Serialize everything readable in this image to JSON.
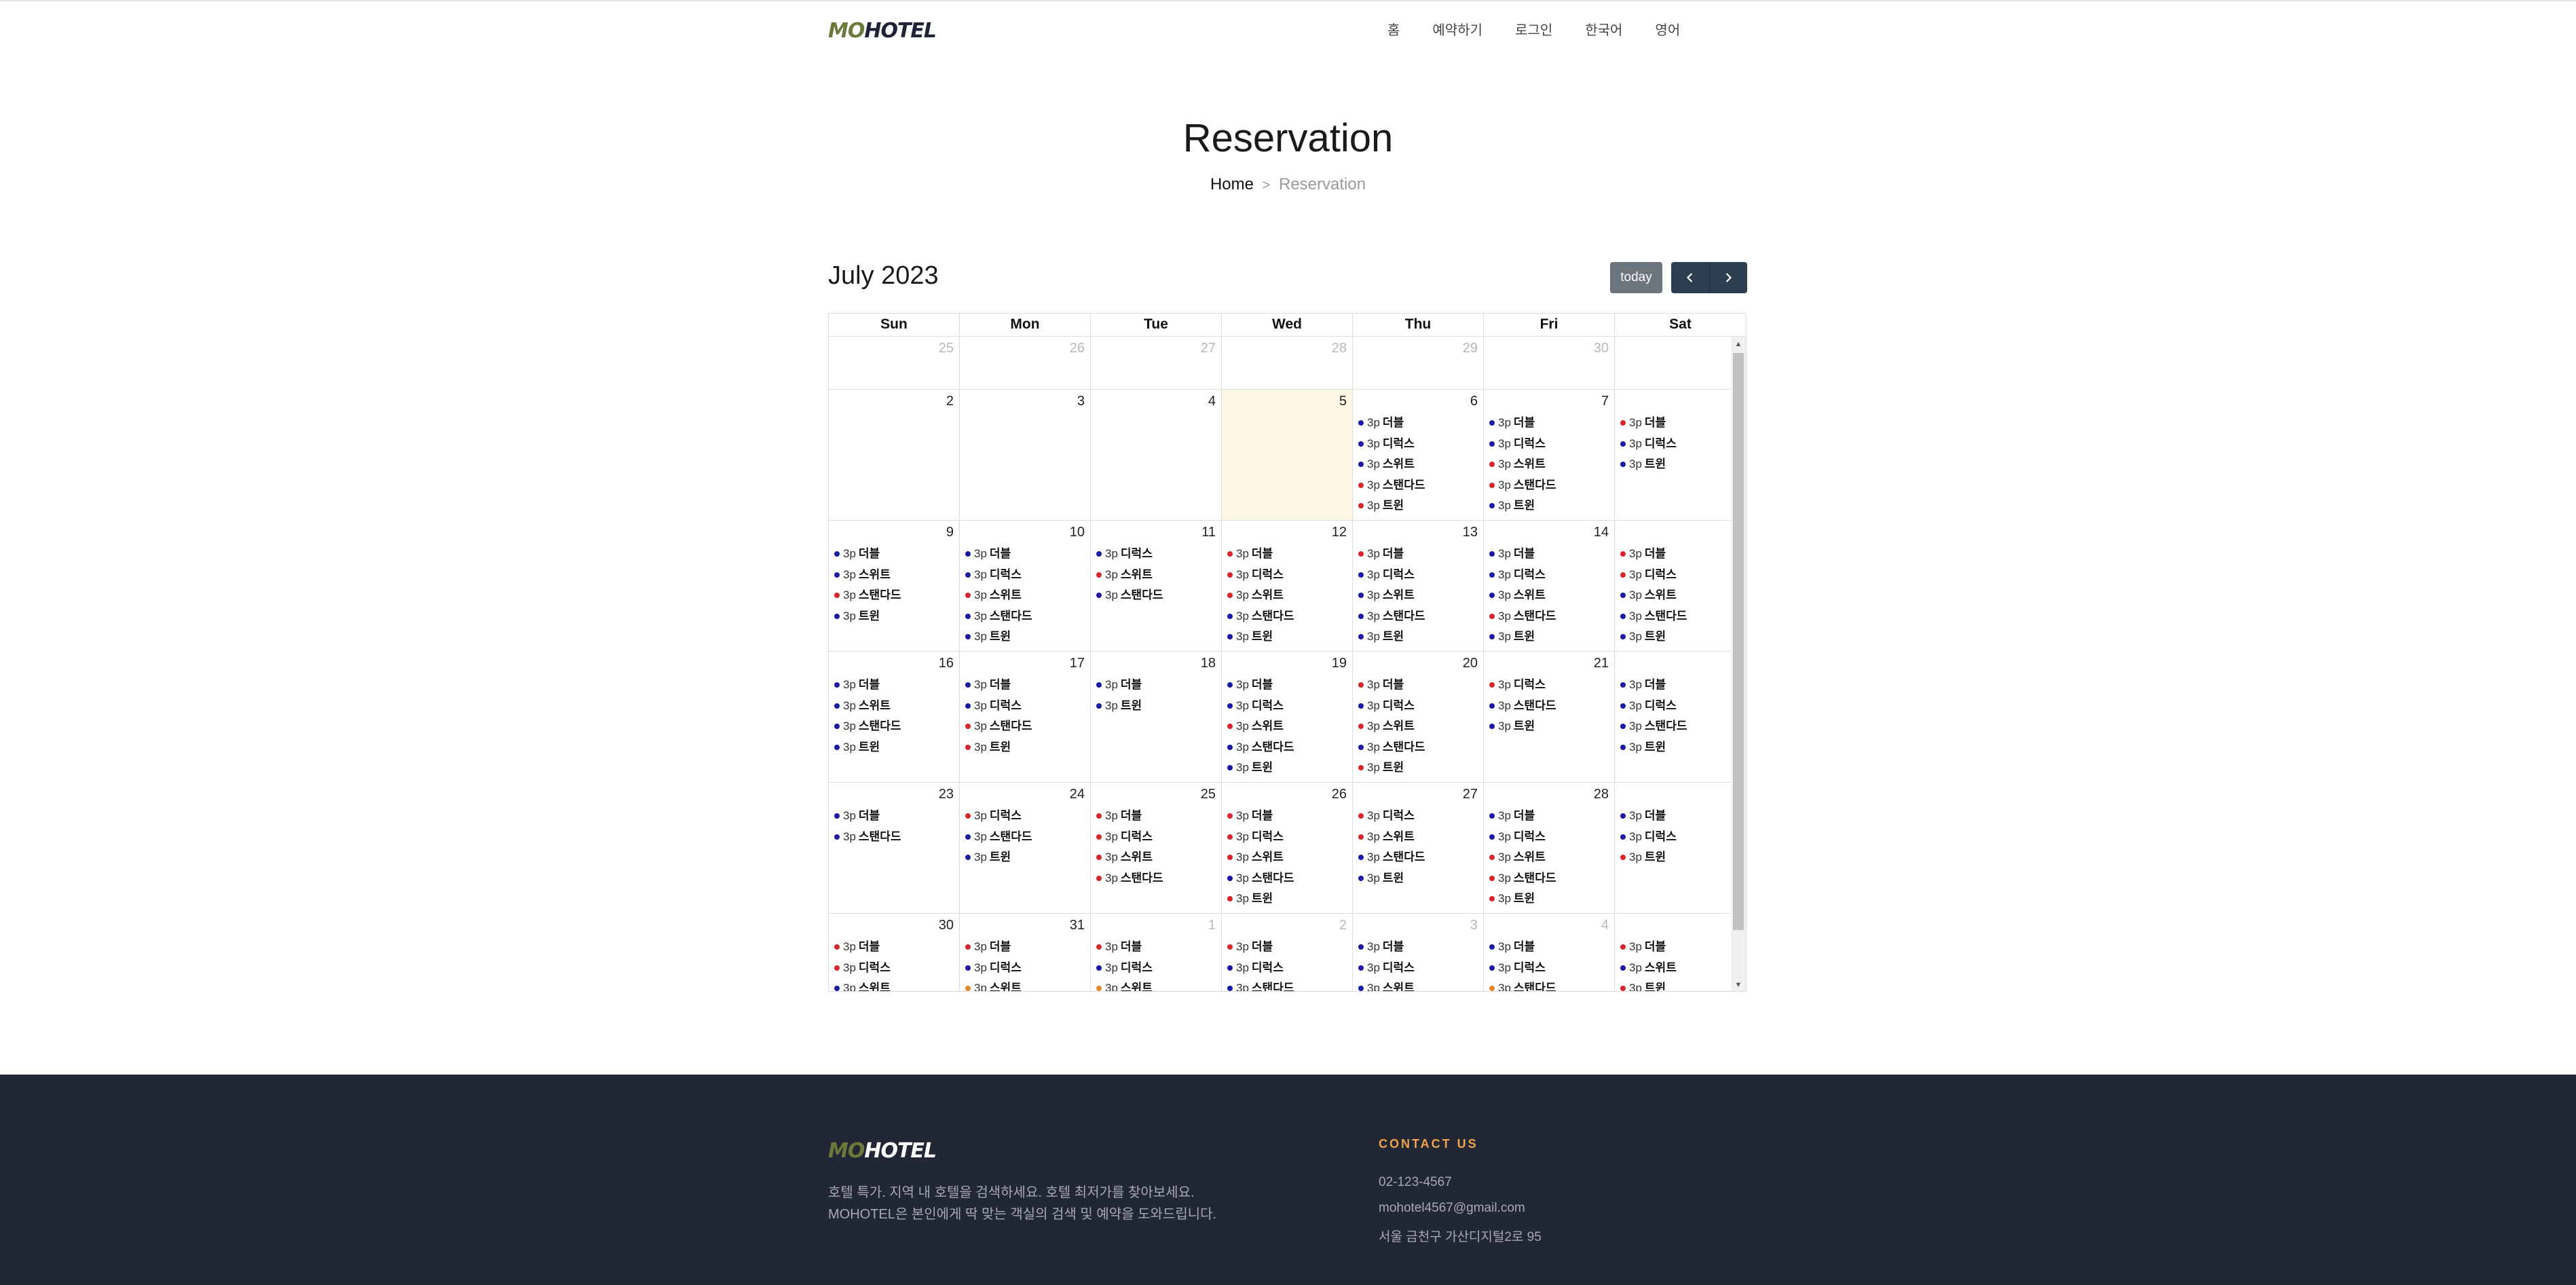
{
  "nav": {
    "logo": {
      "part1": "MO",
      "part2": "HOTEL"
    },
    "links": [
      "홈",
      "예약하기",
      "로그인",
      "한국어",
      "영어"
    ]
  },
  "hero": {
    "title": "Reservation",
    "breadcrumb": {
      "home": "Home",
      "separator": ">",
      "current": "Reservation"
    }
  },
  "calendar": {
    "title": "July 2023",
    "today_label": "today",
    "weekdays": [
      "Sun",
      "Mon",
      "Tue",
      "Wed",
      "Thu",
      "Fri",
      "Sat"
    ],
    "colors": {
      "blue": "#1a1aa6",
      "red": "#d9262c",
      "orange": "#e08a2a",
      "today_bg": "#fcf8e3"
    },
    "weeks": [
      [
        {
          "day": "25",
          "other": true,
          "events": []
        },
        {
          "day": "26",
          "other": true,
          "events": []
        },
        {
          "day": "27",
          "other": true,
          "events": []
        },
        {
          "day": "28",
          "other": true,
          "events": []
        },
        {
          "day": "29",
          "other": true,
          "events": []
        },
        {
          "day": "30",
          "other": true,
          "events": []
        },
        {
          "day": "",
          "other": false,
          "events": []
        }
      ],
      [
        {
          "day": "2",
          "events": []
        },
        {
          "day": "3",
          "events": []
        },
        {
          "day": "4",
          "events": []
        },
        {
          "day": "5",
          "today": true,
          "events": []
        },
        {
          "day": "6",
          "events": [
            {
              "time": "3p",
              "name": "더블",
              "color": "blue"
            },
            {
              "time": "3p",
              "name": "디럭스",
              "color": "blue"
            },
            {
              "time": "3p",
              "name": "스위트",
              "color": "blue"
            },
            {
              "time": "3p",
              "name": "스탠다드",
              "color": "red"
            },
            {
              "time": "3p",
              "name": "트윈",
              "color": "red"
            }
          ]
        },
        {
          "day": "7",
          "events": [
            {
              "time": "3p",
              "name": "더블",
              "color": "blue"
            },
            {
              "time": "3p",
              "name": "디럭스",
              "color": "blue"
            },
            {
              "time": "3p",
              "name": "스위트",
              "color": "red"
            },
            {
              "time": "3p",
              "name": "스탠다드",
              "color": "red"
            },
            {
              "time": "3p",
              "name": "트윈",
              "color": "blue"
            }
          ]
        },
        {
          "day": "",
          "events": [
            {
              "time": "3p",
              "name": "더블",
              "color": "red"
            },
            {
              "time": "3p",
              "name": "디럭스",
              "color": "blue"
            },
            {
              "time": "3p",
              "name": "트윈",
              "color": "blue"
            }
          ]
        }
      ],
      [
        {
          "day": "9",
          "events": [
            {
              "time": "3p",
              "name": "더블",
              "color": "blue"
            },
            {
              "time": "3p",
              "name": "스위트",
              "color": "blue"
            },
            {
              "time": "3p",
              "name": "스탠다드",
              "color": "red"
            },
            {
              "time": "3p",
              "name": "트윈",
              "color": "blue"
            }
          ]
        },
        {
          "day": "10",
          "events": [
            {
              "time": "3p",
              "name": "더블",
              "color": "blue"
            },
            {
              "time": "3p",
              "name": "디럭스",
              "color": "blue"
            },
            {
              "time": "3p",
              "name": "스위트",
              "color": "red"
            },
            {
              "time": "3p",
              "name": "스탠다드",
              "color": "blue"
            },
            {
              "time": "3p",
              "name": "트윈",
              "color": "blue"
            }
          ]
        },
        {
          "day": "11",
          "events": [
            {
              "time": "3p",
              "name": "디럭스",
              "color": "blue"
            },
            {
              "time": "3p",
              "name": "스위트",
              "color": "red"
            },
            {
              "time": "3p",
              "name": "스탠다드",
              "color": "blue"
            }
          ]
        },
        {
          "day": "12",
          "events": [
            {
              "time": "3p",
              "name": "더블",
              "color": "red"
            },
            {
              "time": "3p",
              "name": "디럭스",
              "color": "red"
            },
            {
              "time": "3p",
              "name": "스위트",
              "color": "red"
            },
            {
              "time": "3p",
              "name": "스탠다드",
              "color": "blue"
            },
            {
              "time": "3p",
              "name": "트윈",
              "color": "blue"
            }
          ]
        },
        {
          "day": "13",
          "events": [
            {
              "time": "3p",
              "name": "더블",
              "color": "red"
            },
            {
              "time": "3p",
              "name": "디럭스",
              "color": "blue"
            },
            {
              "time": "3p",
              "name": "스위트",
              "color": "blue"
            },
            {
              "time": "3p",
              "name": "스탠다드",
              "color": "blue"
            },
            {
              "time": "3p",
              "name": "트윈",
              "color": "blue"
            }
          ]
        },
        {
          "day": "14",
          "events": [
            {
              "time": "3p",
              "name": "더블",
              "color": "blue"
            },
            {
              "time": "3p",
              "name": "디럭스",
              "color": "blue"
            },
            {
              "time": "3p",
              "name": "스위트",
              "color": "blue"
            },
            {
              "time": "3p",
              "name": "스탠다드",
              "color": "red"
            },
            {
              "time": "3p",
              "name": "트윈",
              "color": "blue"
            }
          ]
        },
        {
          "day": "",
          "events": [
            {
              "time": "3p",
              "name": "더블",
              "color": "red"
            },
            {
              "time": "3p",
              "name": "디럭스",
              "color": "red"
            },
            {
              "time": "3p",
              "name": "스위트",
              "color": "blue"
            },
            {
              "time": "3p",
              "name": "스탠다드",
              "color": "blue"
            },
            {
              "time": "3p",
              "name": "트윈",
              "color": "blue"
            }
          ]
        }
      ],
      [
        {
          "day": "16",
          "events": [
            {
              "time": "3p",
              "name": "더블",
              "color": "blue"
            },
            {
              "time": "3p",
              "name": "스위트",
              "color": "blue"
            },
            {
              "time": "3p",
              "name": "스탠다드",
              "color": "blue"
            },
            {
              "time": "3p",
              "name": "트윈",
              "color": "blue"
            }
          ]
        },
        {
          "day": "17",
          "events": [
            {
              "time": "3p",
              "name": "더블",
              "color": "blue"
            },
            {
              "time": "3p",
              "name": "디럭스",
              "color": "blue"
            },
            {
              "time": "3p",
              "name": "스탠다드",
              "color": "red"
            },
            {
              "time": "3p",
              "name": "트윈",
              "color": "red"
            }
          ]
        },
        {
          "day": "18",
          "events": [
            {
              "time": "3p",
              "name": "더블",
              "color": "blue"
            },
            {
              "time": "3p",
              "name": "트윈",
              "color": "blue"
            }
          ]
        },
        {
          "day": "19",
          "events": [
            {
              "time": "3p",
              "name": "더블",
              "color": "blue"
            },
            {
              "time": "3p",
              "name": "디럭스",
              "color": "blue"
            },
            {
              "time": "3p",
              "name": "스위트",
              "color": "red"
            },
            {
              "time": "3p",
              "name": "스탠다드",
              "color": "blue"
            },
            {
              "time": "3p",
              "name": "트윈",
              "color": "blue"
            }
          ]
        },
        {
          "day": "20",
          "events": [
            {
              "time": "3p",
              "name": "더블",
              "color": "red"
            },
            {
              "time": "3p",
              "name": "디럭스",
              "color": "blue"
            },
            {
              "time": "3p",
              "name": "스위트",
              "color": "red"
            },
            {
              "time": "3p",
              "name": "스탠다드",
              "color": "blue"
            },
            {
              "time": "3p",
              "name": "트윈",
              "color": "red"
            }
          ]
        },
        {
          "day": "21",
          "events": [
            {
              "time": "3p",
              "name": "디럭스",
              "color": "red"
            },
            {
              "time": "3p",
              "name": "스탠다드",
              "color": "blue"
            },
            {
              "time": "3p",
              "name": "트윈",
              "color": "blue"
            }
          ]
        },
        {
          "day": "",
          "events": [
            {
              "time": "3p",
              "name": "더블",
              "color": "blue"
            },
            {
              "time": "3p",
              "name": "디럭스",
              "color": "blue"
            },
            {
              "time": "3p",
              "name": "스탠다드",
              "color": "blue"
            },
            {
              "time": "3p",
              "name": "트윈",
              "color": "blue"
            }
          ]
        }
      ],
      [
        {
          "day": "23",
          "events": [
            {
              "time": "3p",
              "name": "더블",
              "color": "blue"
            },
            {
              "time": "3p",
              "name": "스탠다드",
              "color": "blue"
            }
          ]
        },
        {
          "day": "24",
          "events": [
            {
              "time": "3p",
              "name": "디럭스",
              "color": "red"
            },
            {
              "time": "3p",
              "name": "스탠다드",
              "color": "blue"
            },
            {
              "time": "3p",
              "name": "트윈",
              "color": "blue"
            }
          ]
        },
        {
          "day": "25",
          "events": [
            {
              "time": "3p",
              "name": "더블",
              "color": "red"
            },
            {
              "time": "3p",
              "name": "디럭스",
              "color": "red"
            },
            {
              "time": "3p",
              "name": "스위트",
              "color": "red"
            },
            {
              "time": "3p",
              "name": "스탠다드",
              "color": "red"
            }
          ]
        },
        {
          "day": "26",
          "events": [
            {
              "time": "3p",
              "name": "더블",
              "color": "red"
            },
            {
              "time": "3p",
              "name": "디럭스",
              "color": "red"
            },
            {
              "time": "3p",
              "name": "스위트",
              "color": "red"
            },
            {
              "time": "3p",
              "name": "스탠다드",
              "color": "blue"
            },
            {
              "time": "3p",
              "name": "트윈",
              "color": "red"
            }
          ]
        },
        {
          "day": "27",
          "events": [
            {
              "time": "3p",
              "name": "디럭스",
              "color": "red"
            },
            {
              "time": "3p",
              "name": "스위트",
              "color": "red"
            },
            {
              "time": "3p",
              "name": "스탠다드",
              "color": "blue"
            },
            {
              "time": "3p",
              "name": "트윈",
              "color": "blue"
            }
          ]
        },
        {
          "day": "28",
          "events": [
            {
              "time": "3p",
              "name": "더블",
              "color": "blue"
            },
            {
              "time": "3p",
              "name": "디럭스",
              "color": "blue"
            },
            {
              "time": "3p",
              "name": "스위트",
              "color": "red"
            },
            {
              "time": "3p",
              "name": "스탠다드",
              "color": "red"
            },
            {
              "time": "3p",
              "name": "트윈",
              "color": "red"
            }
          ]
        },
        {
          "day": "",
          "events": [
            {
              "time": "3p",
              "name": "더블",
              "color": "blue"
            },
            {
              "time": "3p",
              "name": "디럭스",
              "color": "blue"
            },
            {
              "time": "3p",
              "name": "트윈",
              "color": "red"
            }
          ]
        }
      ],
      [
        {
          "day": "30",
          "events": [
            {
              "time": "3p",
              "name": "더블",
              "color": "red"
            },
            {
              "time": "3p",
              "name": "디럭스",
              "color": "red"
            },
            {
              "time": "3p",
              "name": "스위트",
              "color": "blue"
            }
          ]
        },
        {
          "day": "31",
          "events": [
            {
              "time": "3p",
              "name": "더블",
              "color": "red"
            },
            {
              "time": "3p",
              "name": "디럭스",
              "color": "blue"
            },
            {
              "time": "3p",
              "name": "스위트",
              "color": "orange"
            }
          ]
        },
        {
          "day": "1",
          "other": true,
          "events": [
            {
              "time": "3p",
              "name": "더블",
              "color": "red"
            },
            {
              "time": "3p",
              "name": "디럭스",
              "color": "blue"
            },
            {
              "time": "3p",
              "name": "스위트",
              "color": "orange"
            }
          ]
        },
        {
          "day": "2",
          "other": true,
          "events": [
            {
              "time": "3p",
              "name": "더블",
              "color": "red"
            },
            {
              "time": "3p",
              "name": "디럭스",
              "color": "blue"
            },
            {
              "time": "3p",
              "name": "스탠다드",
              "color": "blue"
            }
          ]
        },
        {
          "day": "3",
          "other": true,
          "events": [
            {
              "time": "3p",
              "name": "더블",
              "color": "blue"
            },
            {
              "time": "3p",
              "name": "디럭스",
              "color": "blue"
            },
            {
              "time": "3p",
              "name": "스위트",
              "color": "blue"
            }
          ]
        },
        {
          "day": "4",
          "other": true,
          "events": [
            {
              "time": "3p",
              "name": "더블",
              "color": "blue"
            },
            {
              "time": "3p",
              "name": "디럭스",
              "color": "blue"
            },
            {
              "time": "3p",
              "name": "스탠다드",
              "color": "orange"
            }
          ]
        },
        {
          "day": "",
          "other": true,
          "events": [
            {
              "time": "3p",
              "name": "더블",
              "color": "red"
            },
            {
              "time": "3p",
              "name": "스위트",
              "color": "blue"
            },
            {
              "time": "3p",
              "name": "트윈",
              "color": "red"
            }
          ]
        }
      ]
    ]
  },
  "footer": {
    "logo": {
      "part1": "MO",
      "part2": "HOTEL"
    },
    "description_line1": "호텔 특가. 지역 내 호텔을 검색하세요. 호텔 최저가를 찾아보세요.",
    "description_line2": "MOHOTEL은 본인에게 딱 맞는 객실의 검색 및 예약을 도와드립니다.",
    "contact_title": "CONTACT US",
    "phone": "02-123-4567",
    "email": "mohotel4567@gmail.com",
    "address": "서울 금천구 가산디지털2로 95"
  }
}
